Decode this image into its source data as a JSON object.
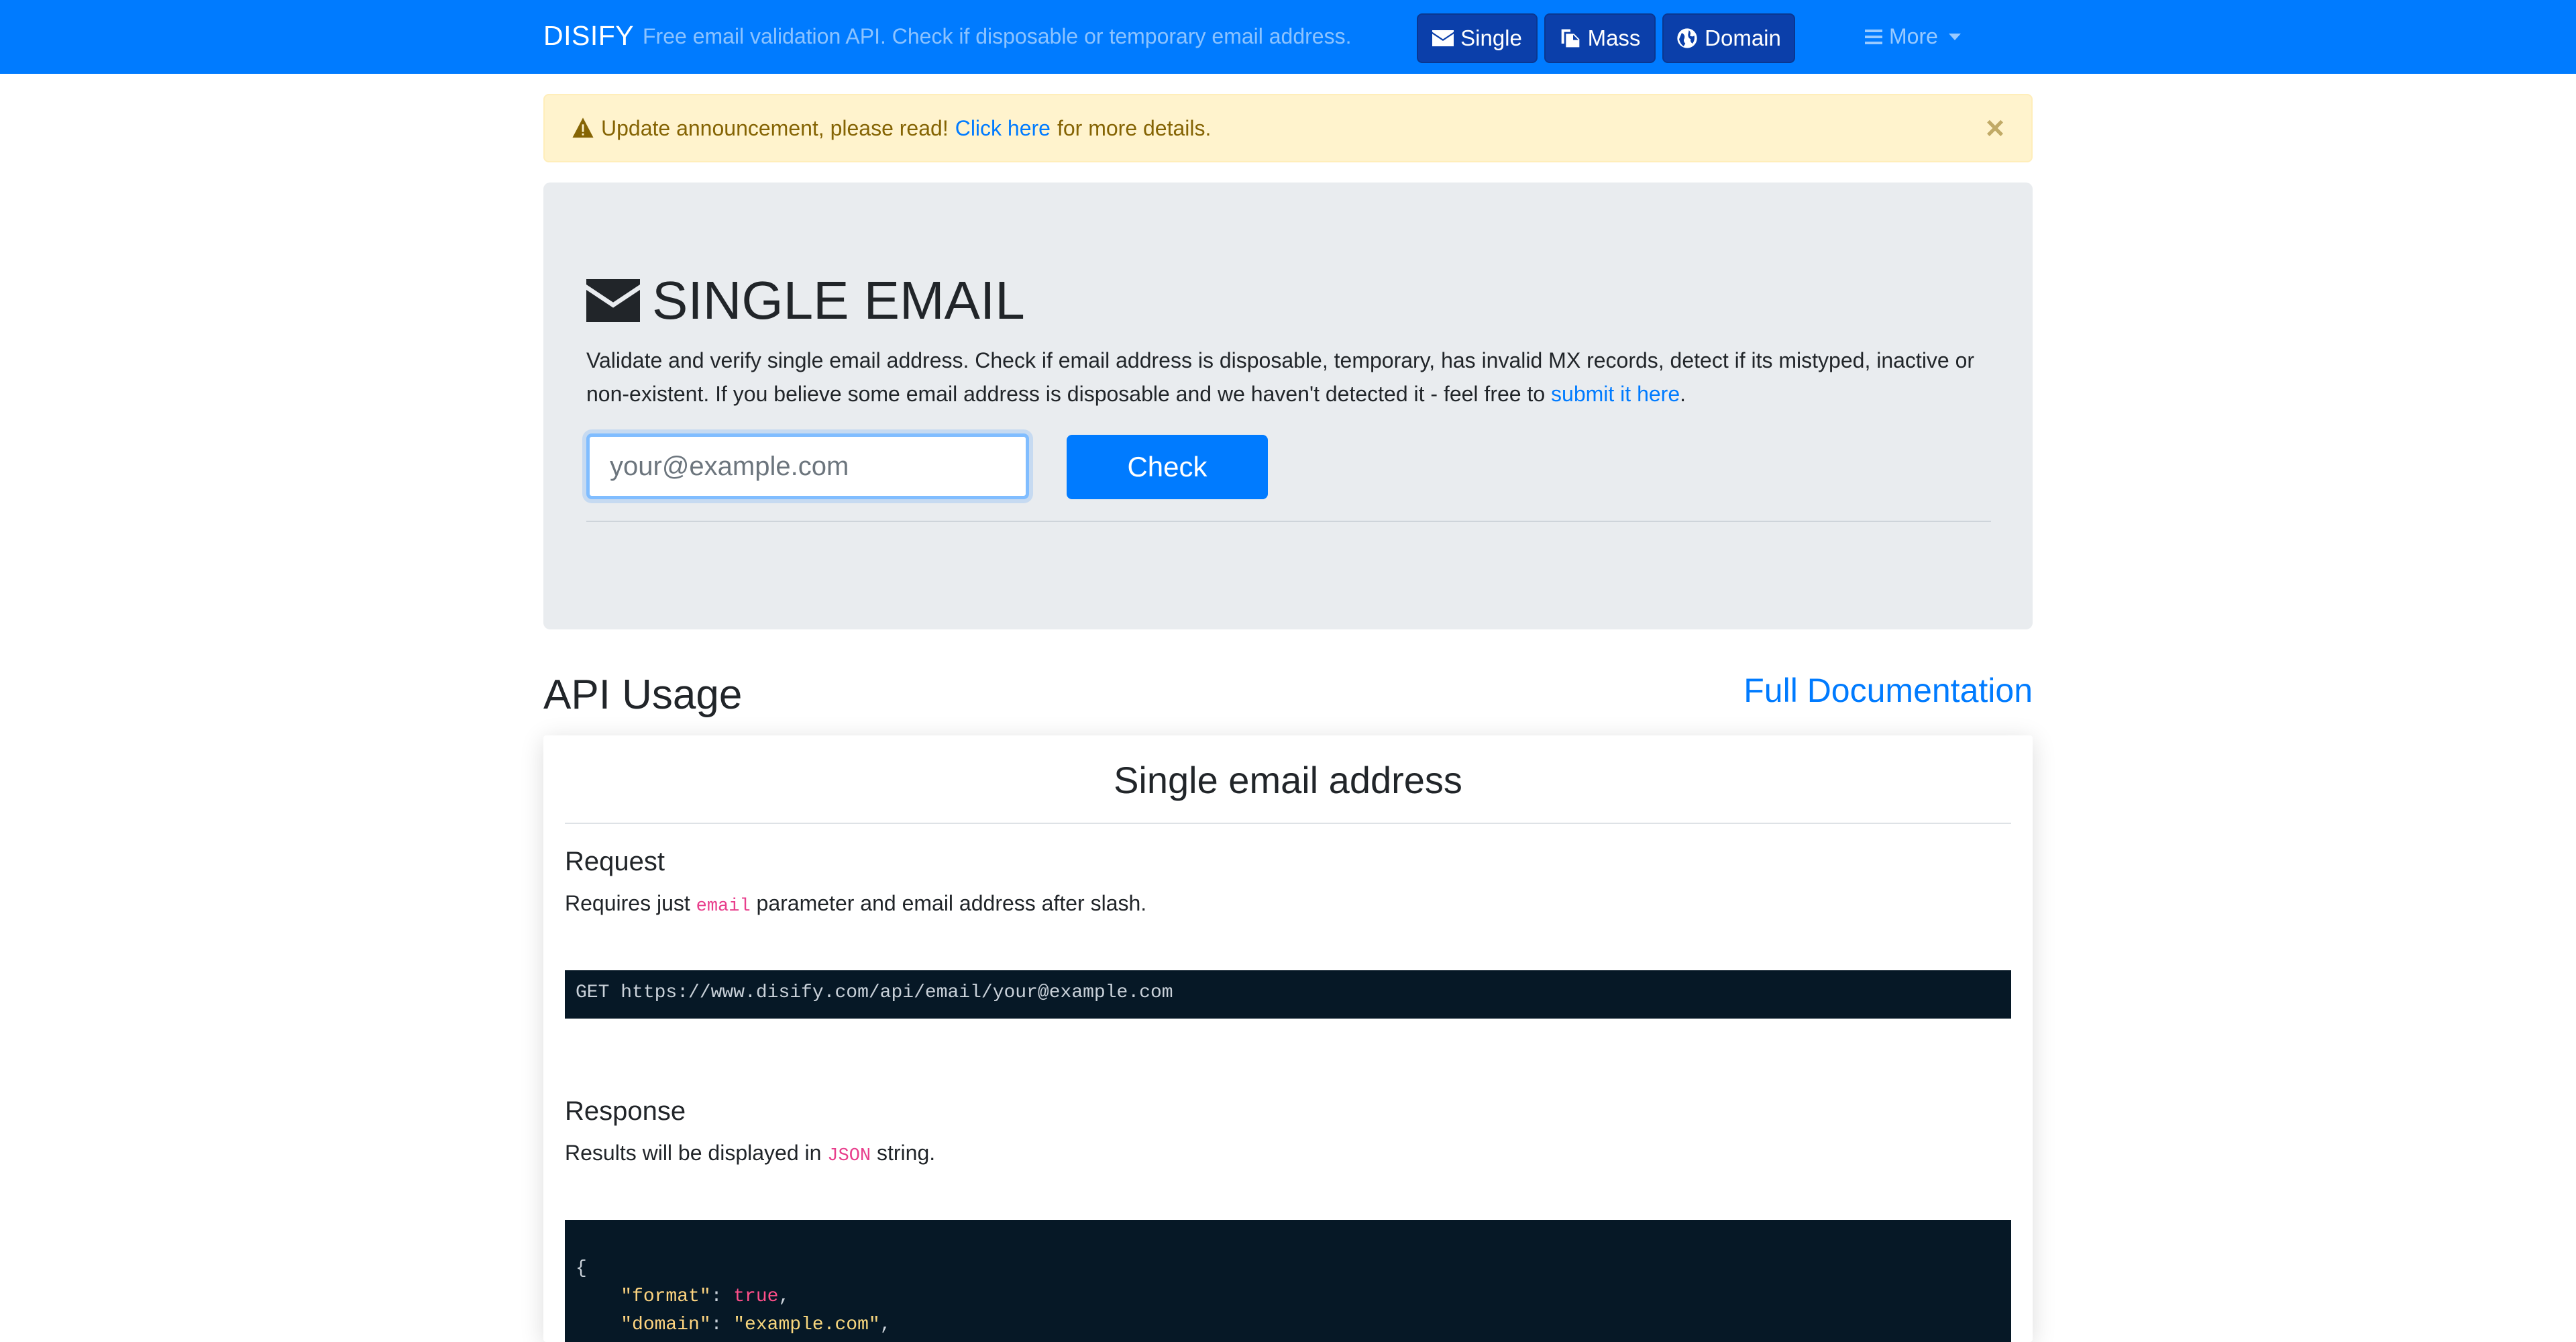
{
  "navbar": {
    "brand": "DISIFY",
    "tagline": "Free email validation API. Check if disposable or temporary email address.",
    "buttons": [
      {
        "label": "Single",
        "icon": "envelope-icon"
      },
      {
        "label": "Mass",
        "icon": "copy-icon"
      },
      {
        "label": "Domain",
        "icon": "globe-icon"
      }
    ],
    "more_label": "More",
    "accent": "#007bff"
  },
  "alert": {
    "prefix": "Update announcement, please read!",
    "link": "Click here",
    "suffix": "for more details.",
    "close": "×"
  },
  "jumbotron": {
    "title": "SINGLE EMAIL",
    "desc_1": "Validate and verify single email address. Check if email address is disposable, temporary, has invalid MX records, detect if its mistyped, inactive or non-existent. If you believe some email address is disposable and we haven't detected it - feel free to",
    "desc_link": "submit it here",
    "desc_end": ".",
    "input_placeholder": "your@example.com",
    "button_label": "Check"
  },
  "api": {
    "title": "API Usage",
    "doc_link": "Full Documentation"
  },
  "card": {
    "title": "Single email address",
    "request": {
      "title": "Request",
      "text_before": "Requires just",
      "code": "email",
      "text_after": "parameter and email address after slash.",
      "example": "GET https://www.disify.com/api/email/your@example.com"
    },
    "response": {
      "title": "Response",
      "text_before": "Results will be displayed in",
      "code": "JSON",
      "text_after": "string.",
      "json_open": "{",
      "line1_key": "\"format\"",
      "line1_val": "true",
      "line2_key": "\"domain\"",
      "line2_val": "\"example.com\""
    }
  }
}
